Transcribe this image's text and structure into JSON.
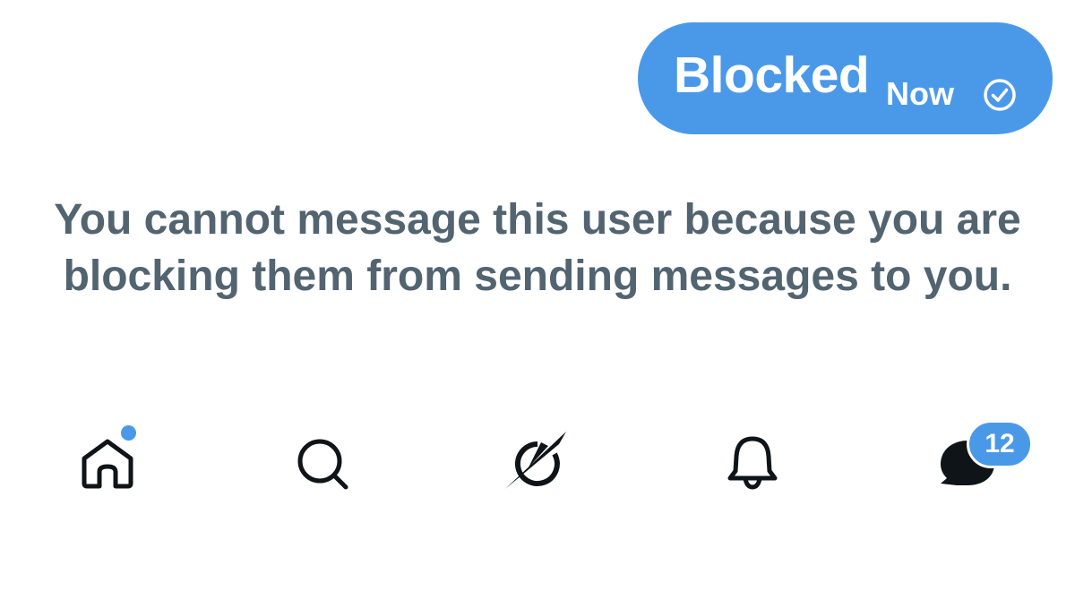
{
  "message_bubble": {
    "text": "Blocked",
    "timestamp": "Now",
    "status_icon": "check-circle-icon",
    "color": "#4a99e9"
  },
  "notice": {
    "text": "You cannot message this user because you are blocking them from sending messages to you.",
    "color": "#536471"
  },
  "bottom_nav": {
    "items": [
      {
        "name": "home",
        "icon": "home-icon",
        "has_notification_dot": true
      },
      {
        "name": "search",
        "icon": "search-icon"
      },
      {
        "name": "grok",
        "icon": "grok-icon"
      },
      {
        "name": "notifications",
        "icon": "bell-icon"
      },
      {
        "name": "messages",
        "icon": "messages-icon",
        "badge": "12"
      }
    ],
    "accent_color": "#4a99e9"
  }
}
